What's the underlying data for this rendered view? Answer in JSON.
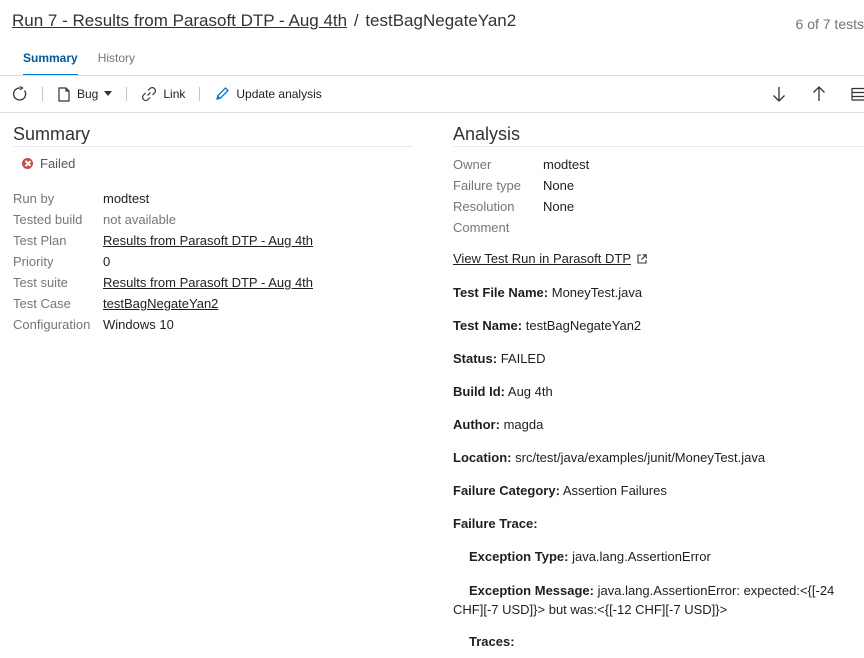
{
  "header": {
    "run_link": "Run 7 - Results from Parasoft DTP - Aug 4th",
    "separator": "/",
    "test_name": "testBagNegateYan2",
    "counter": "6 of 7 tests"
  },
  "tabs": [
    {
      "label": "Summary",
      "active": true
    },
    {
      "label": "History",
      "active": false
    }
  ],
  "toolbar": {
    "refresh_icon": "refresh-icon",
    "bug_label": "Bug",
    "link_label": "Link",
    "update_label": "Update analysis",
    "down_icon": "arrow-down-icon",
    "up_icon": "arrow-up-icon",
    "list_icon": "list-icon"
  },
  "summary": {
    "title": "Summary",
    "status": "Failed",
    "fields": [
      {
        "key": "Run by",
        "value": "modtest",
        "link": false,
        "muted": false
      },
      {
        "key": "Tested build",
        "value": "not available",
        "link": false,
        "muted": true
      },
      {
        "key": "Test Plan",
        "value": "Results from Parasoft DTP - Aug 4th",
        "link": true,
        "muted": false
      },
      {
        "key": "Priority",
        "value": "0",
        "link": false,
        "muted": false
      },
      {
        "key": "Test suite",
        "value": "Results from Parasoft DTP - Aug 4th",
        "link": true,
        "muted": false
      },
      {
        "key": "Test Case",
        "value": "testBagNegateYan2",
        "link": true,
        "muted": false
      },
      {
        "key": "Configuration",
        "value": "Windows 10",
        "link": false,
        "muted": false
      }
    ]
  },
  "analysis": {
    "title": "Analysis",
    "fields": [
      {
        "key": "Owner",
        "value": "modtest"
      },
      {
        "key": "Failure type",
        "value": "None"
      },
      {
        "key": "Resolution",
        "value": "None"
      },
      {
        "key": "Comment",
        "value": ""
      }
    ],
    "view_link": "View Test Run in Parasoft DTP",
    "details": [
      {
        "label": "Test File Name:",
        "value": "MoneyTest.java"
      },
      {
        "label": "Test Name:",
        "value": "testBagNegateYan2"
      },
      {
        "label": "Status:",
        "value": "FAILED"
      },
      {
        "label": "Build Id:",
        "value": "Aug 4th"
      },
      {
        "label": "Author:",
        "value": "magda"
      },
      {
        "label": "Location:",
        "value": "src/test/java/examples/junit/MoneyTest.java"
      },
      {
        "label": "Failure Category:",
        "value": "Assertion Failures"
      },
      {
        "label": "Failure Trace:",
        "value": ""
      }
    ],
    "trace": {
      "exception_type_label": "Exception Type:",
      "exception_type": "java.lang.AssertionError",
      "exception_message_label": "Exception Message:",
      "exception_message": "java.lang.AssertionError: expected:<{[-24 CHF][-7 USD]}> but was:<{[-12 CHF][-7 USD]}>",
      "traces_label": "Traces:"
    }
  }
}
